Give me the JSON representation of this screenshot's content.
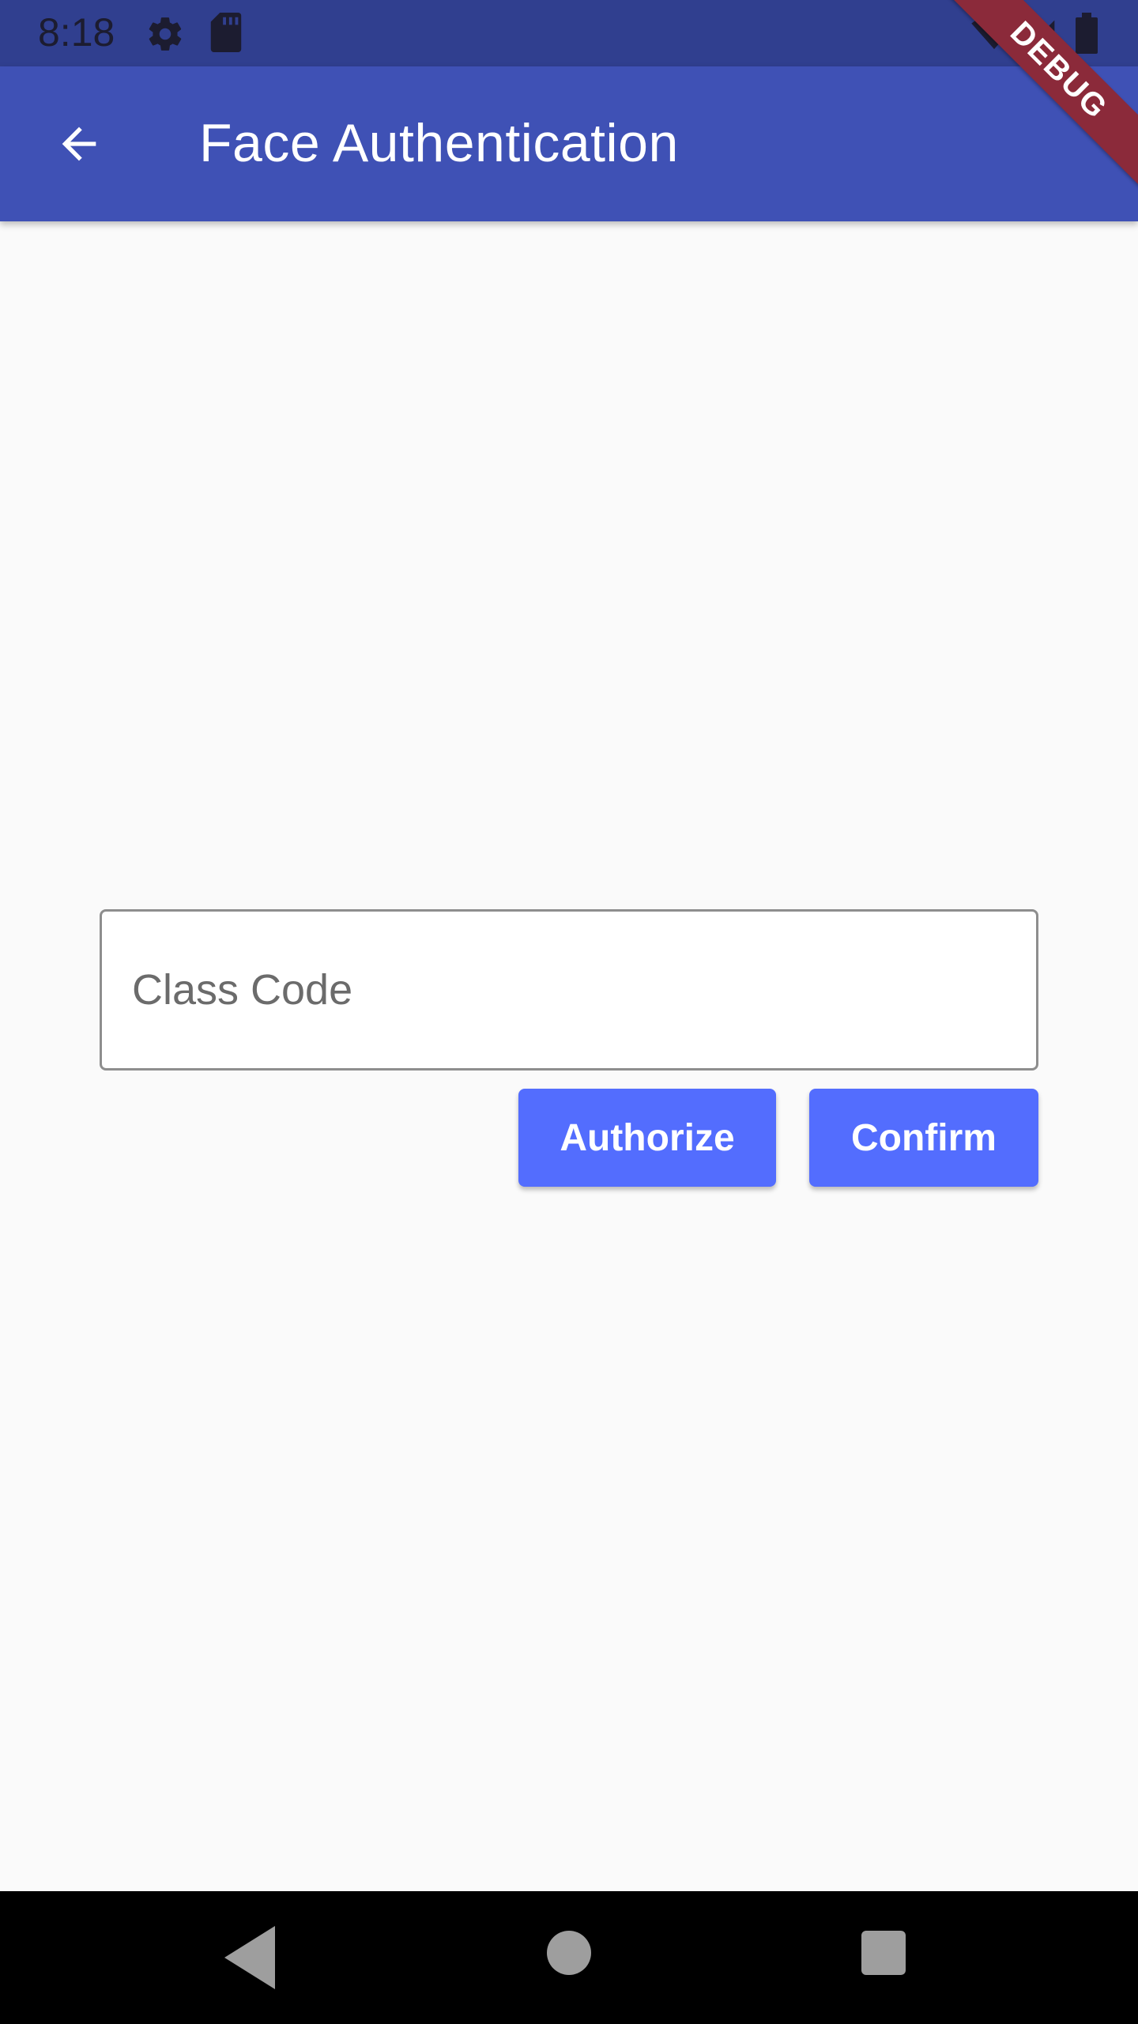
{
  "status_bar": {
    "time": "8:18",
    "icons": [
      "gear-icon",
      "sd-card-icon",
      "wifi-off-icon",
      "signal-icon",
      "battery-icon"
    ]
  },
  "app_bar": {
    "title": "Face Authentication",
    "back_icon": "arrow-back-icon",
    "color": "#3f51b5"
  },
  "debug_banner": {
    "label": "DEBUG",
    "color": "#8b2a3a"
  },
  "form": {
    "class_code": {
      "placeholder": "Class Code",
      "value": ""
    },
    "authorize_label": "Authorize",
    "confirm_label": "Confirm",
    "button_color": "#536dfe"
  },
  "nav_bar": {
    "icons": [
      "nav-back-icon",
      "nav-home-icon",
      "nav-recents-icon"
    ]
  }
}
